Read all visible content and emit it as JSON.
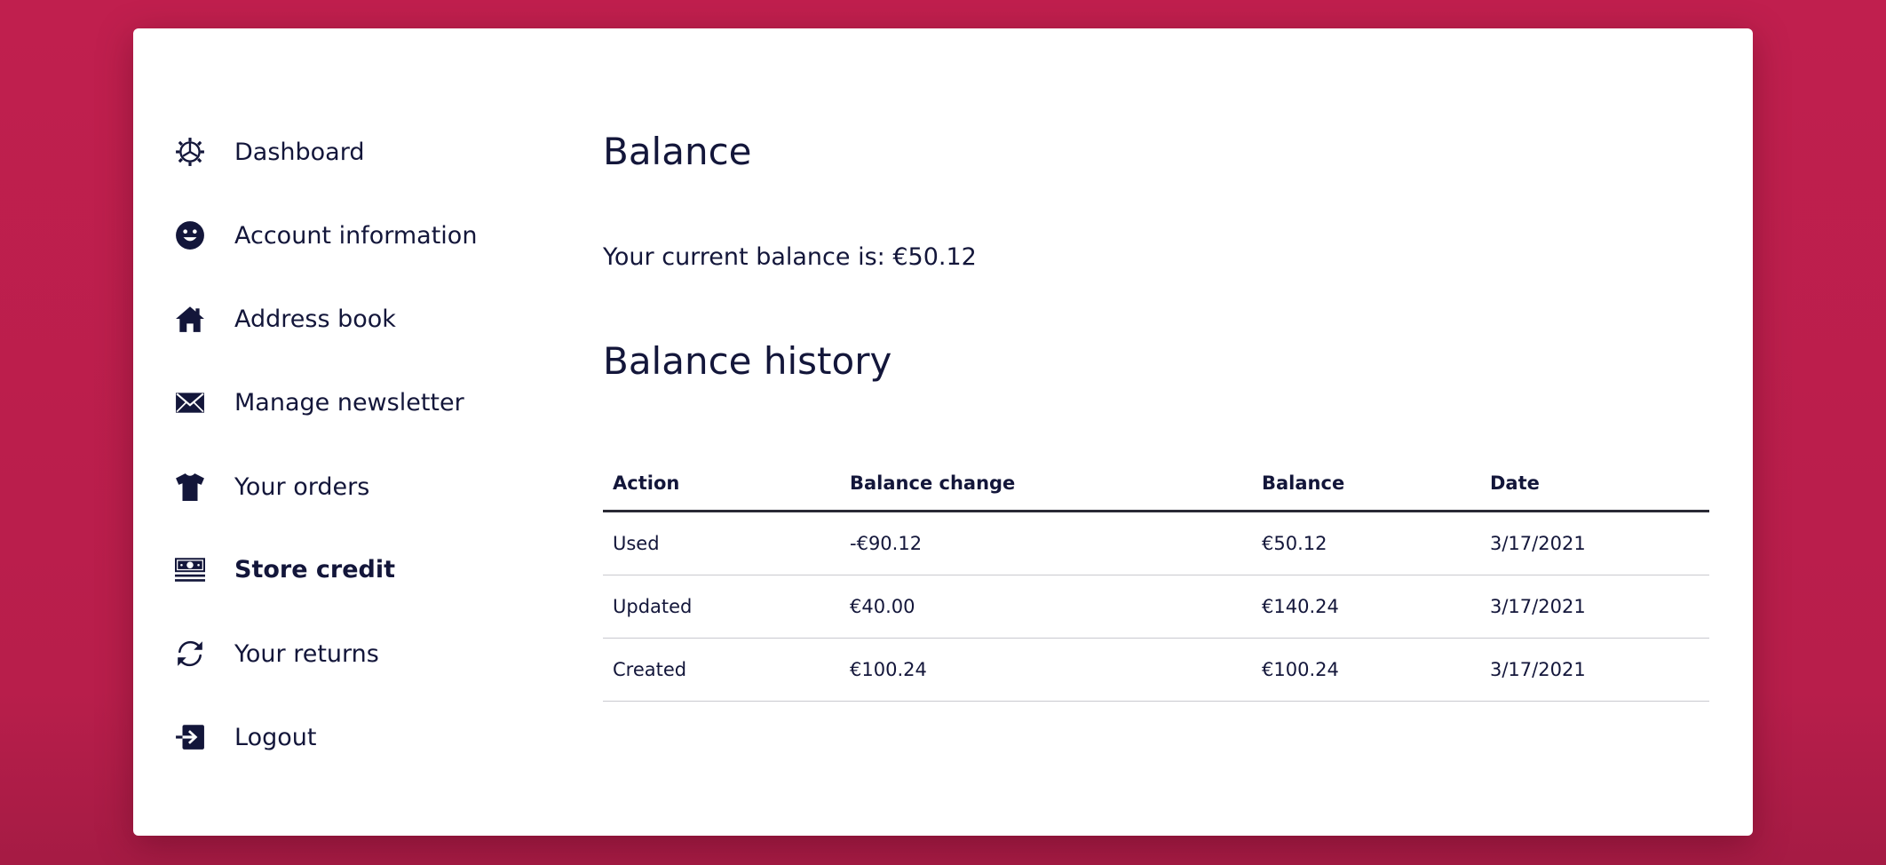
{
  "sidebar": {
    "items": [
      {
        "label": "Dashboard",
        "icon": "gear-icon",
        "active": false
      },
      {
        "label": "Account information",
        "icon": "smiley-icon",
        "active": false
      },
      {
        "label": "Address book",
        "icon": "house-icon",
        "active": false
      },
      {
        "label": "Manage newsletter",
        "icon": "envelope-icon",
        "active": false
      },
      {
        "label": "Your orders",
        "icon": "tshirt-icon",
        "active": false
      },
      {
        "label": "Store credit",
        "icon": "banknote-icon",
        "active": true
      },
      {
        "label": "Your returns",
        "icon": "refresh-icon",
        "active": false
      },
      {
        "label": "Logout",
        "icon": "logout-icon",
        "active": false
      }
    ]
  },
  "main": {
    "title": "Balance",
    "current_balance_text": "Your current balance is: €50.12",
    "history_title": "Balance history",
    "table": {
      "headers": [
        "Action",
        "Balance change",
        "Balance",
        "Date"
      ],
      "rows": [
        [
          "Used",
          "-€90.12",
          "€50.12",
          "3/17/2021"
        ],
        [
          "Updated",
          "€40.00",
          "€140.24",
          "3/17/2021"
        ],
        [
          "Created",
          "€100.24",
          "€100.24",
          "3/17/2021"
        ]
      ]
    }
  },
  "colors": {
    "background": "#c01f4e",
    "text": "#13163a",
    "card": "#ffffff"
  }
}
